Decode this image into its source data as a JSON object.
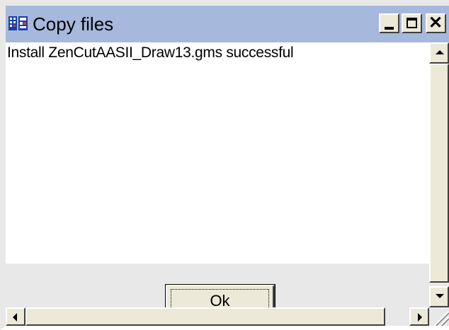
{
  "window": {
    "title": "Copy files",
    "title_icon": "app-icon",
    "controls": {
      "minimize_icon": "minimize-icon",
      "maximize_icon": "maximize-icon",
      "close_icon": "close-icon",
      "close_glyph": "✕"
    }
  },
  "content": {
    "message": "Install ZenCutAASII_Draw13.gms successful"
  },
  "footer": {
    "ok_label": "Ok"
  },
  "scrollbars": {
    "up_icon": "arrow-up-icon",
    "down_icon": "arrow-down-icon",
    "left_icon": "arrow-left-icon",
    "right_icon": "arrow-right-icon"
  },
  "colors": {
    "titlebar": "#a6b8dc",
    "face": "#ece9d8",
    "background": "#ffffff"
  }
}
